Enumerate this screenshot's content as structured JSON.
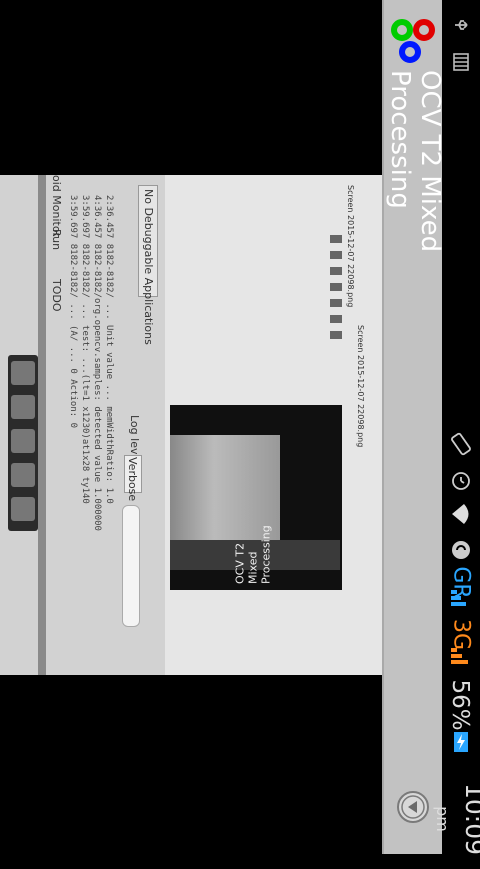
{
  "status_bar": {
    "time": "10:09",
    "ampm": "pm",
    "battery": "56%",
    "network_type": "3G",
    "network_roaming": "GR",
    "icons": [
      "usb-icon",
      "storage-icon",
      "screen-rotation-icon",
      "alarm-icon",
      "wifi-icon",
      "sync-icon",
      "signal-icon",
      "battery-charging-icon"
    ]
  },
  "action_bar": {
    "title": "OCV T2 Mixed Processing",
    "logo_icon": "opencv-logo-icon",
    "overflow_icon": "overflow-menu-icon"
  },
  "preview": {
    "inner_app_title": "OCV T2 Mixed Processing",
    "debuggable_label": "No Debuggable Applications",
    "log_level_label": "Log level:",
    "log_level_value": "Verbose",
    "menu_labels": [
      "Run",
      "TODO"
    ],
    "monitor_label": "oid Monitor",
    "window_titles": [
      "Screen 2015-12-07 22098.png",
      "Screen 2015-12-07 22098.png"
    ],
    "log_lines": [
      "2:36.457 8182-8182/ ... Unit value ... memWidthRatio: 1.0",
      "4:36.457 8182-8182/org.opencv.samples: detected value 1.000000",
      "3:59.697 8182-8182/ ... test: ...(lt=1 x1230)at1x28 ty140",
      "3:59.697 8182-8182/ ... (A/ ... 0 Action: 0"
    ]
  },
  "colors": {
    "action_bar_bg": "#c2c2c2",
    "three_g_orange": "#ff8a1c",
    "roaming_blue": "#2aa6ff"
  }
}
